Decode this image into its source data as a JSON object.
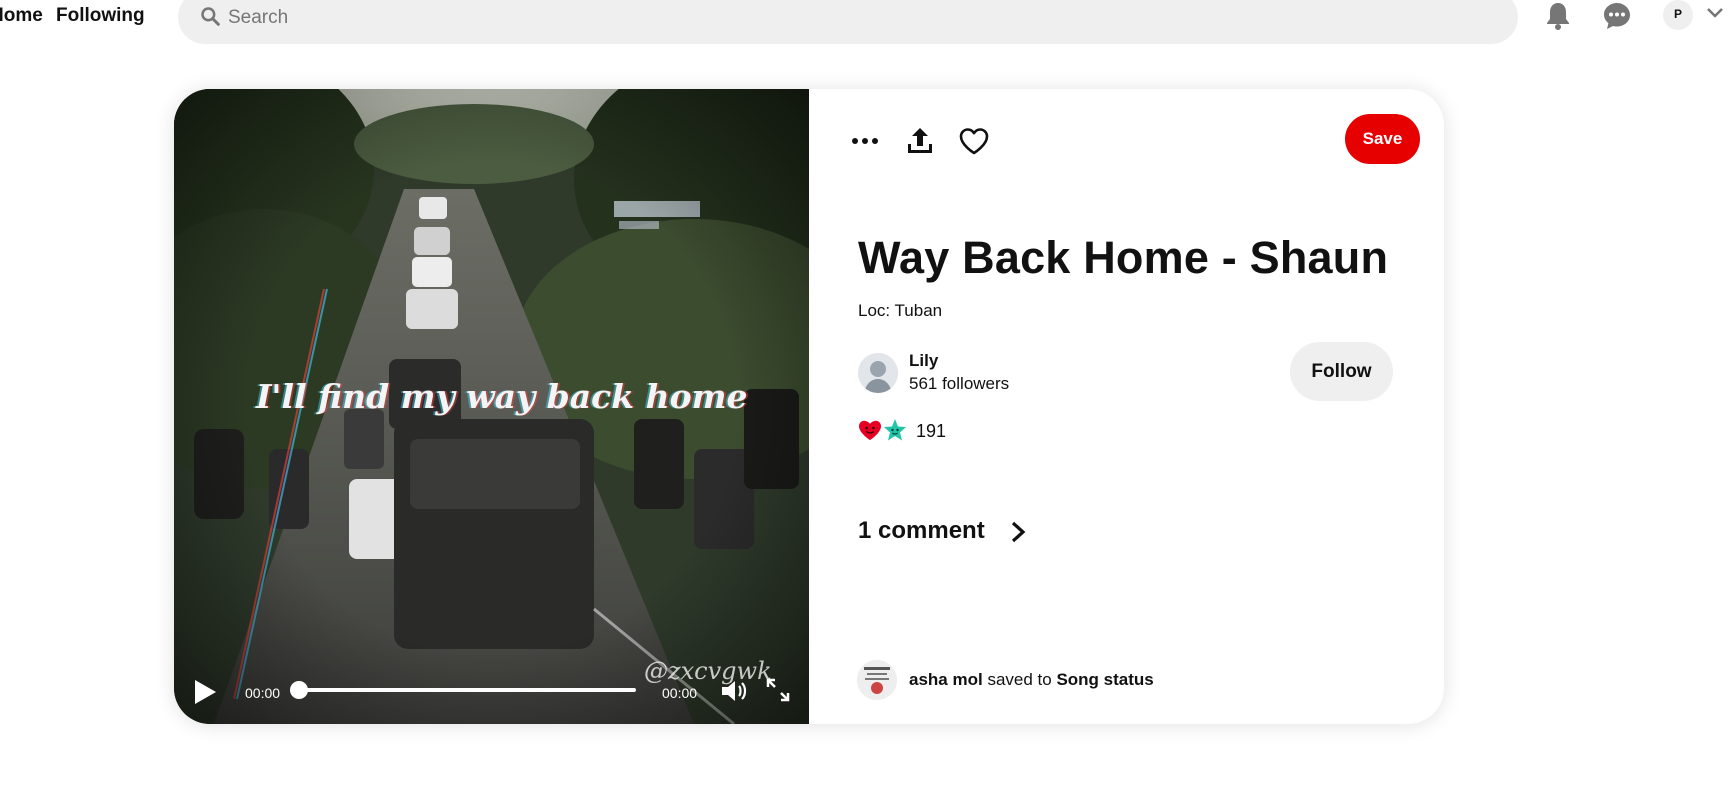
{
  "header": {
    "nav": {
      "home_label": "Home",
      "following_label": "Following"
    },
    "search": {
      "placeholder": "Search",
      "value": ""
    },
    "profile_initial": "P"
  },
  "pin": {
    "title": "Way Back Home - Shaun",
    "description": "Loc: Tuban",
    "save_label": "Save",
    "video": {
      "caption": "I'll find my way back home",
      "watermark": "@zxcvgwk",
      "current_time": "00:00",
      "duration": "00:00",
      "progress": 0
    },
    "creator": {
      "name": "Lily",
      "followers": "561 followers",
      "follow_label": "Follow"
    },
    "reactions": {
      "count": "191"
    },
    "comments": {
      "label": "1 comment"
    },
    "saved_by": {
      "user": "asha mol",
      "connector": "saved to",
      "board": "Song status"
    }
  },
  "colors": {
    "save_red": "#e60000",
    "search_bg": "#efefef",
    "follow_bg": "#efefef",
    "reaction_heart": "#e60023",
    "reaction_star": "#21c5a7"
  },
  "icons": {
    "search": "search-icon",
    "bell": "bell-icon",
    "chat": "chat-icon",
    "caret": "chevron-down-icon",
    "more": "more-icon",
    "share": "share-icon",
    "heart": "heart-icon",
    "play": "play-icon",
    "volume": "volume-icon",
    "fullscreen": "fullscreen-icon",
    "comments_chevron": "chevron-right-icon"
  }
}
